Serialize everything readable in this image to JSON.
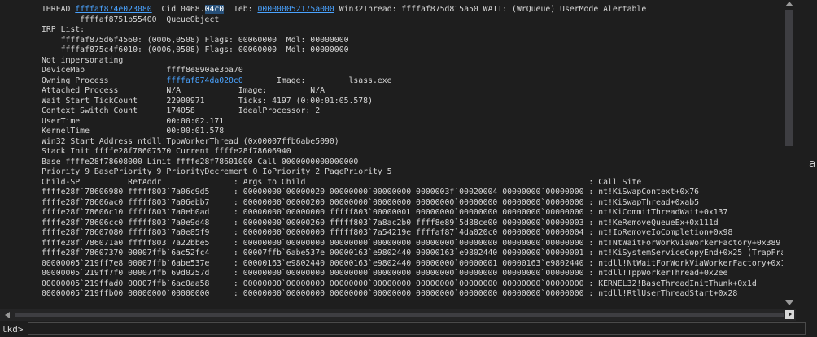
{
  "thread": {
    "prefix": "THREAD ",
    "thread_addr": "ffffaf874e023080",
    "cid_label": "  Cid 0468.",
    "cid_selected": "04c0",
    "teb_label": "  Teb: ",
    "teb_addr": "000000052175a000",
    "rest": " Win32Thread: ffffaf875d815a50 WAIT: (WrQueue) UserMode Alertable"
  },
  "queue_line": "        ffffaf8751b55400  QueueObject",
  "irp_header": "IRP List:",
  "irp_lines": [
    "    ffffaf875d6f4560: (0006,0508) Flags: 00060000  Mdl: 00000000",
    "    ffffaf875c4f6010: (0006,0508) Flags: 00060000  Mdl: 00000000"
  ],
  "not_impersonating": "Not impersonating",
  "device_map": "DeviceMap                 ffff8e890ae3ba70",
  "owning_process": {
    "label": "Owning Process            ",
    "addr": "ffffaf874da020c0",
    "rest": "       Image:         lsass.exe"
  },
  "info_lines": [
    "Attached Process          N/A            Image:         N/A",
    "Wait Start TickCount      22900971       Ticks: 4197 (0:00:01:05.578)",
    "Context Switch Count      174058         IdealProcessor: 2",
    "UserTime                  00:00:02.171",
    "KernelTime                00:00:01.578",
    "Win32 Start Address ntdll!TppWorkerThread (0x00007ffb6abe5090)",
    "Stack Init ffffe28f78607570 Current ffffe28f78606940",
    "Base ffffe28f78608000 Limit ffffe28f78601000 Call 0000000000000000",
    "Priority 9 BasePriority 9 PriorityDecrement 0 IoPriority 2 PagePriority 5"
  ],
  "stack_header": "Child-SP          RetAddr               : Args to Child                                                           : Call Site",
  "stack_frames": [
    "ffffe28f`78606980 fffff803`7a06c9d5     : 00000000`00000020 00000000`00000000 0000003f`00020004 00000000`00000000 : nt!KiSwapContext+0x76",
    "ffffe28f`78606ac0 fffff803`7a06ebb7     : 00000000`00000200 00000000`00000000 00000000`00000000 00000000`00000000 : nt!KiSwapThread+0xab5",
    "ffffe28f`78606c10 fffff803`7a0eb0ad     : 00000000`00000000 fffff803`00000001 00000000`00000000 00000000`00000000 : nt!KiCommitThreadWait+0x137",
    "ffffe28f`78606cc0 fffff803`7a0e9d48     : 00000000`00000260 fffff803`7a8ac2b0 ffff8e89`5d88ce00 00000000`00000003 : nt!KeRemoveQueueEx+0x111d",
    "ffffe28f`78607080 fffff803`7a0e85f9     : 00000000`00000000 fffff803`7a54219e ffffaf87`4da020c0 00000000`00000004 : nt!IoRemoveIoCompletion+0x98",
    "ffffe28f`786071a0 fffff803`7a22bbe5     : 00000000`00000000 00000000`00000000 00000000`00000000 00000000`00000000 : nt!NtWaitForWorkViaWorkerFactory+0x389",
    "ffffe28f`78607370 00007ffb`6ac52fc4     : 00007ffb`6abe537e 00000163`e9802440 00000163`e9802440 00000000`00000001 : nt!KiSystemServiceCopyEnd+0x25 (TrapFrame @",
    "00000005`219ff7e8 00007ffb`6abe537e     : 00000163`e9802440 00000163`e9802440 00000000`00000001 00000163`e9802440 : ntdll!NtWaitForWorkViaWorkerFactory+0x14",
    "00000005`219ff7f0 00007ffb`69d0257d     : 00000000`00000000 00000000`00000000 00000000`00000000 00000000`00000000 : ntdll!TppWorkerThread+0x2ee",
    "00000005`219ffad0 00007ffb`6ac0aa58     : 00000000`00000000 00000000`00000000 00000000`00000000 00000000`00000000 : KERNEL32!BaseThreadInitThunk+0x1d",
    "00000005`219ffb00 00000000`00000000     : 00000000`00000000 00000000`00000000 00000000`00000000 00000000`00000000 : ntdll!RtlUserThreadStart+0x28"
  ],
  "edge_char": "a",
  "command": {
    "prompt": "lkd>",
    "value": ""
  },
  "colors": {
    "background": "#1e1e1e",
    "text": "#d7d7d7",
    "link": "#4aa3ff",
    "selection": "#264f78"
  },
  "icons": [
    "scroll-up-icon",
    "scroll-down-icon",
    "scroll-left-icon",
    "scroll-right-icon"
  ]
}
